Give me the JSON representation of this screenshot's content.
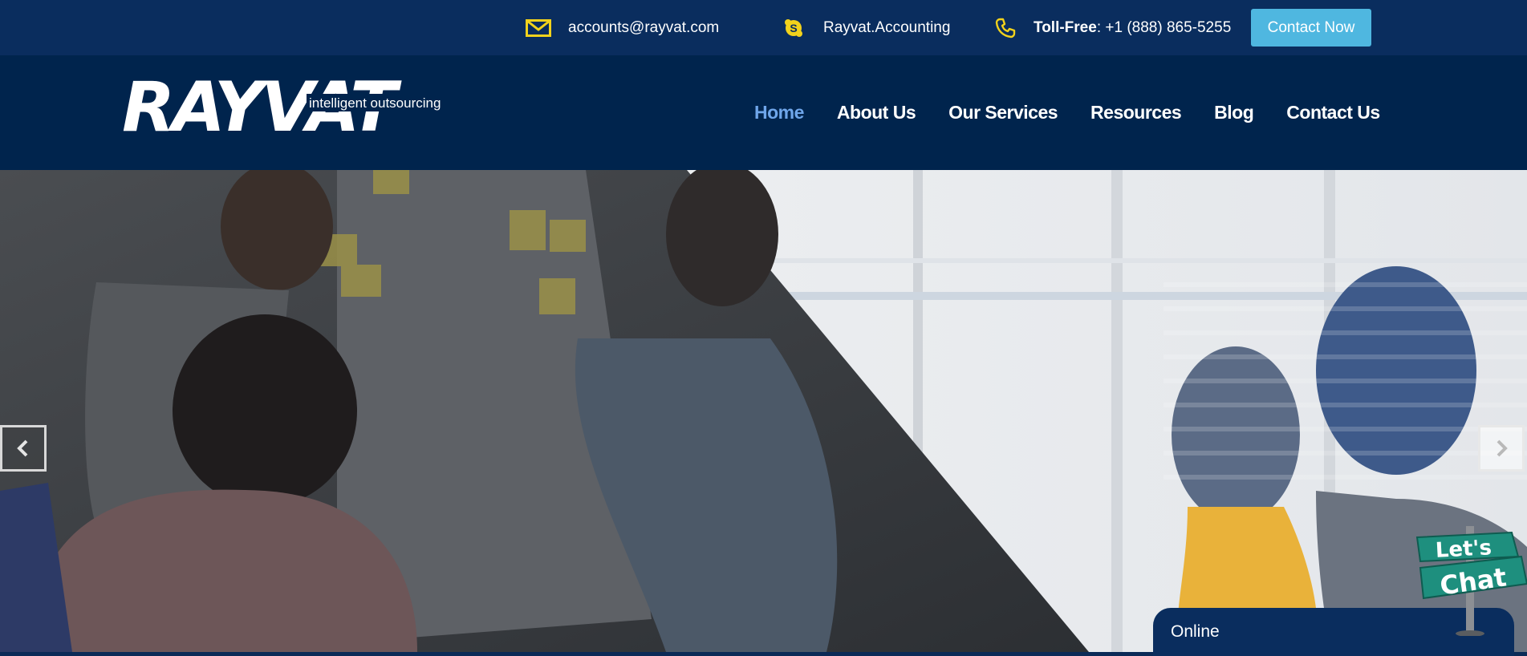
{
  "topbar": {
    "email": {
      "text": "accounts@rayvat.com",
      "icon": "envelope-icon"
    },
    "skype": {
      "text": "Rayvat.Accounting",
      "icon": "skype-icon"
    },
    "phone": {
      "label": "Toll-Free",
      "number": " : +1 (888) 865-5255",
      "icon": "phone-icon"
    },
    "cta": "Contact Now"
  },
  "brand": {
    "logo_text": "RAYVAT",
    "tagline": "intelligent outsourcing"
  },
  "nav": {
    "items": [
      {
        "label": "Home",
        "active": true
      },
      {
        "label": "About Us",
        "active": false
      },
      {
        "label": "Our Services",
        "active": false
      },
      {
        "label": "Resources",
        "active": false
      },
      {
        "label": "Blog",
        "active": false
      },
      {
        "label": "Contact Us",
        "active": false
      }
    ]
  },
  "slider": {
    "prev_icon": "chevron-left-icon",
    "next_icon": "chevron-right-icon"
  },
  "chat": {
    "status": "Online",
    "sign_line1": "Let's",
    "sign_line2": "Chat"
  },
  "colors": {
    "topbar": "#0a2d5e",
    "header": "#00244d",
    "accent_cta": "#4fb7e0",
    "nav_active": "#6fa6ea",
    "icon_yellow": "#f2d21c"
  }
}
